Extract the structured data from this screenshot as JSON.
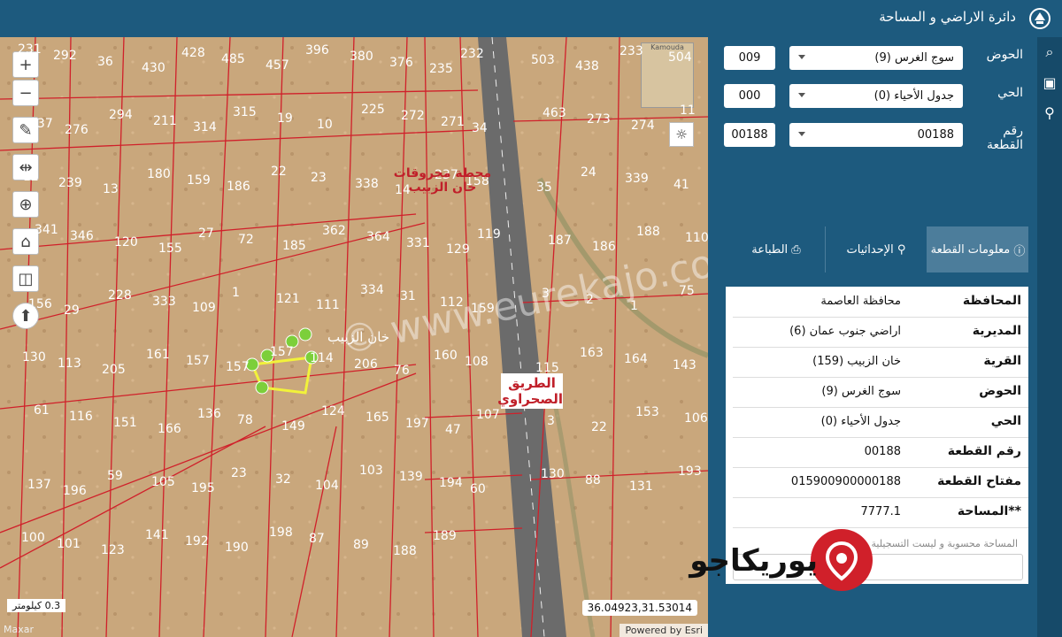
{
  "header": {
    "title": "دائرة الاراضي و المساحة",
    "logo_icon": "jordan-crest-icon",
    "bg_color": "#1d5a7e"
  },
  "map": {
    "zoom_in": "+",
    "zoom_out": "−",
    "parcel_labels": [
      "231",
      "292",
      "36",
      "430",
      "428",
      "485",
      "457",
      "396",
      "380",
      "376",
      "235",
      "232",
      "503",
      "438",
      "233",
      "504",
      "437",
      "276",
      "294",
      "211",
      "314",
      "315",
      "19",
      "10",
      "225",
      "272",
      "271",
      "34",
      "463",
      "273",
      "274",
      "11",
      "12",
      "239",
      "13",
      "180",
      "159",
      "186",
      "22",
      "23",
      "338",
      "14",
      "237",
      "158",
      "35",
      "24",
      "339",
      "41",
      "341",
      "346",
      "120",
      "155",
      "27",
      "72",
      "185",
      "362",
      "364",
      "331",
      "129",
      "119",
      "187",
      "186",
      "188",
      "110",
      "156",
      "29",
      "228",
      "333",
      "109",
      "1",
      "121",
      "111",
      "334",
      "31",
      "112",
      "159",
      "3",
      "2",
      "1",
      "75",
      "130",
      "113",
      "205",
      "161",
      "157",
      "157",
      "157",
      "114",
      "206",
      "76",
      "160",
      "108",
      "115",
      "163",
      "164",
      "143",
      "61",
      "116",
      "151",
      "166",
      "136",
      "78",
      "149",
      "124",
      "165",
      "197",
      "47",
      "107",
      "3",
      "22",
      "153",
      "106",
      "137",
      "196",
      "59",
      "105",
      "195",
      "23",
      "32",
      "104",
      "103",
      "139",
      "194",
      "60",
      "130",
      "88",
      "131",
      "193",
      "100",
      "101",
      "123",
      "141",
      "192",
      "190",
      "198",
      "87",
      "89",
      "188",
      "189"
    ],
    "station_label": "محطة محروقات خان الزبيب",
    "village_label": "خان الزبيب",
    "road_label": "الطريق الصحراوي",
    "watermark": "© www.eurekajo.com",
    "coords": "36.04923,31.53014",
    "scale": "0.3 كيلومتر",
    "attr_left": "Maxar",
    "attr_right": "Powered by Esri",
    "thumb_text": "Kamouda"
  },
  "search": {
    "basin_label": "الحوض",
    "basin_code": "009",
    "basin_value": "سوج الغرس (9)",
    "district_label": "الحي",
    "district_code": "000",
    "district_value": "جدول الأحياء (0)",
    "parcel_label": "رقم القطعة",
    "parcel_code": "00188",
    "parcel_value": "00188"
  },
  "tabs": {
    "info": "معلومات القطعة",
    "coords": "الإحداثيات",
    "print": "الطباعة"
  },
  "parcel_info": [
    {
      "key": "المحافظة",
      "value": "محافظة العاصمة"
    },
    {
      "key": "المديرية",
      "value": "اراضي جنوب عمان (6)"
    },
    {
      "key": "القرية",
      "value": "خان الزبيب (159)"
    },
    {
      "key": "الحوض",
      "value": "سوج الغرس (9)"
    },
    {
      "key": "الحي",
      "value": "جدول الأحياء (0)"
    },
    {
      "key": "رقم القطعة",
      "value": "00188"
    },
    {
      "key": "مفتاح القطعة",
      "value": "015900900000188"
    },
    {
      "key": "**المساحة",
      "value": "7777.1"
    }
  ],
  "footnote": "المساحة محسوبة و ليست التسجيلية",
  "brand": "يوريكاجو",
  "colors": {
    "accent": "#1d5a7e",
    "tab_active": "#4c7d9b",
    "parcel_line": "#d0202a",
    "brand_red": "#d0202a"
  }
}
